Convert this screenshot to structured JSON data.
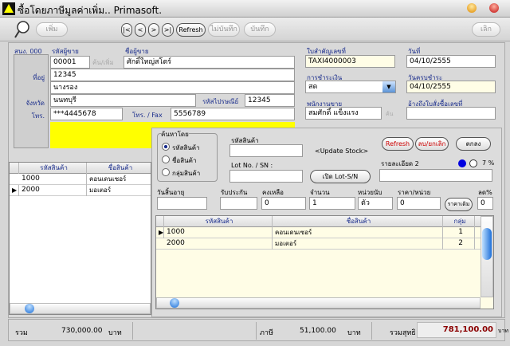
{
  "window": {
    "title": "ซื้อโดยภาษีมูลค่าเพิ่ม.. Primasoft."
  },
  "toolbar": {
    "add": "เพิ่ม",
    "first": "|<",
    "prev": "<",
    "next": ">",
    "last": ">|",
    "refresh": "Refresh",
    "discard": "ไม่บันทึก",
    "save": "บันทึก",
    "exit": "เลิก"
  },
  "header": {
    "branch": "สนง. 000",
    "vendor_code_label": "รหัสผู้ขาย",
    "vendor_code": "00001",
    "find_add": "ค้น/เพิ่ม",
    "vendor_name_label": "ชื่อผู้ขาย",
    "vendor_name": "ศักดิ์ใหญ่สโตร์",
    "address_label": "ที่อยู่",
    "address1": "12345",
    "address2": "นางรอง",
    "province_label": "จังหวัด",
    "province": "นนทบุรี",
    "postcode_label": "รหัสไปรษณีย์",
    "postcode": "12345",
    "phone_label": "โทร.",
    "phone": "***4445678",
    "fax_label": "โทร. / Fax",
    "fax": "5556789",
    "doc_no_label": "ใบสำคัญเลขที่",
    "doc_no": "TAXI4000003",
    "date_label": "วันที่",
    "date": "04/10/2555",
    "payment_label": "การชำระเงิน",
    "payment": "สด",
    "due_label": "วันครบชำระ",
    "due": "04/10/2555",
    "salesman_label": "พนักงานขาย",
    "salesman": "สมศักดิ์ แข็งแรง",
    "find": "ค้น",
    "ref_label": "อ้างถึงใบสั่งซื้อเลขที่",
    "ref": ""
  },
  "left_grid": {
    "columns": [
      "รหัสสินค้า",
      "ชื่อสินค้า"
    ],
    "rows": [
      [
        "1000",
        "คอนเดนเซอร์"
      ],
      [
        "2000",
        "มอเตอร์"
      ]
    ]
  },
  "entry": {
    "search_by": "ค้นหาโดย",
    "options": [
      "รหัสสินค้า",
      "ชื่อสินค้า",
      "กลุ่มสินค้า"
    ],
    "selected": 0,
    "code_label": "รหัสสินค้า",
    "code": "",
    "update_stock": "<Update Stock>",
    "lot_label": "Lot No. / SN :",
    "lot": "",
    "open_lot": "เปิด Lot-S/N",
    "refresh": "Refresh",
    "delete": "ลบ/ยกเลิก",
    "ok": "ตกลง",
    "detail2_label": "รายละเอียด 2",
    "detail2": "",
    "vat_pct": "7 %",
    "expire_label": "วันสิ้นอายุ",
    "expire": "",
    "warranty_label": "รับประกัน",
    "warranty": "",
    "remain_label": "คงเหลือ",
    "remain": "0",
    "qty_label": "จำนวน",
    "qty": "1",
    "unit_label": "หน่วยนับ",
    "unit": "ตัว",
    "price_label": "ราคา/หน่วย",
    "price": "0",
    "orig_price": "ราคาเดิม",
    "disc_label": "ลด%",
    "disc": "0"
  },
  "lower_grid": {
    "columns": [
      "รหัสสินค้า",
      "ชื่อสินค้า",
      "กลุ่ม"
    ],
    "rows": [
      [
        "1000",
        "คอนเดนเซอร์",
        "1"
      ],
      [
        "2000",
        "มอเตอร์",
        "2"
      ]
    ]
  },
  "status": {
    "total_label": "รวม",
    "total": "730,000.00",
    "unit": "บาท",
    "tax_label": "ภาษี",
    "tax": "51,100.00",
    "net_label": "รวมสุทธิ",
    "net": "781,100.00"
  },
  "colors": {
    "label": "#1a2d8c",
    "highlight": "#ffff00",
    "net": "#8b0000"
  }
}
